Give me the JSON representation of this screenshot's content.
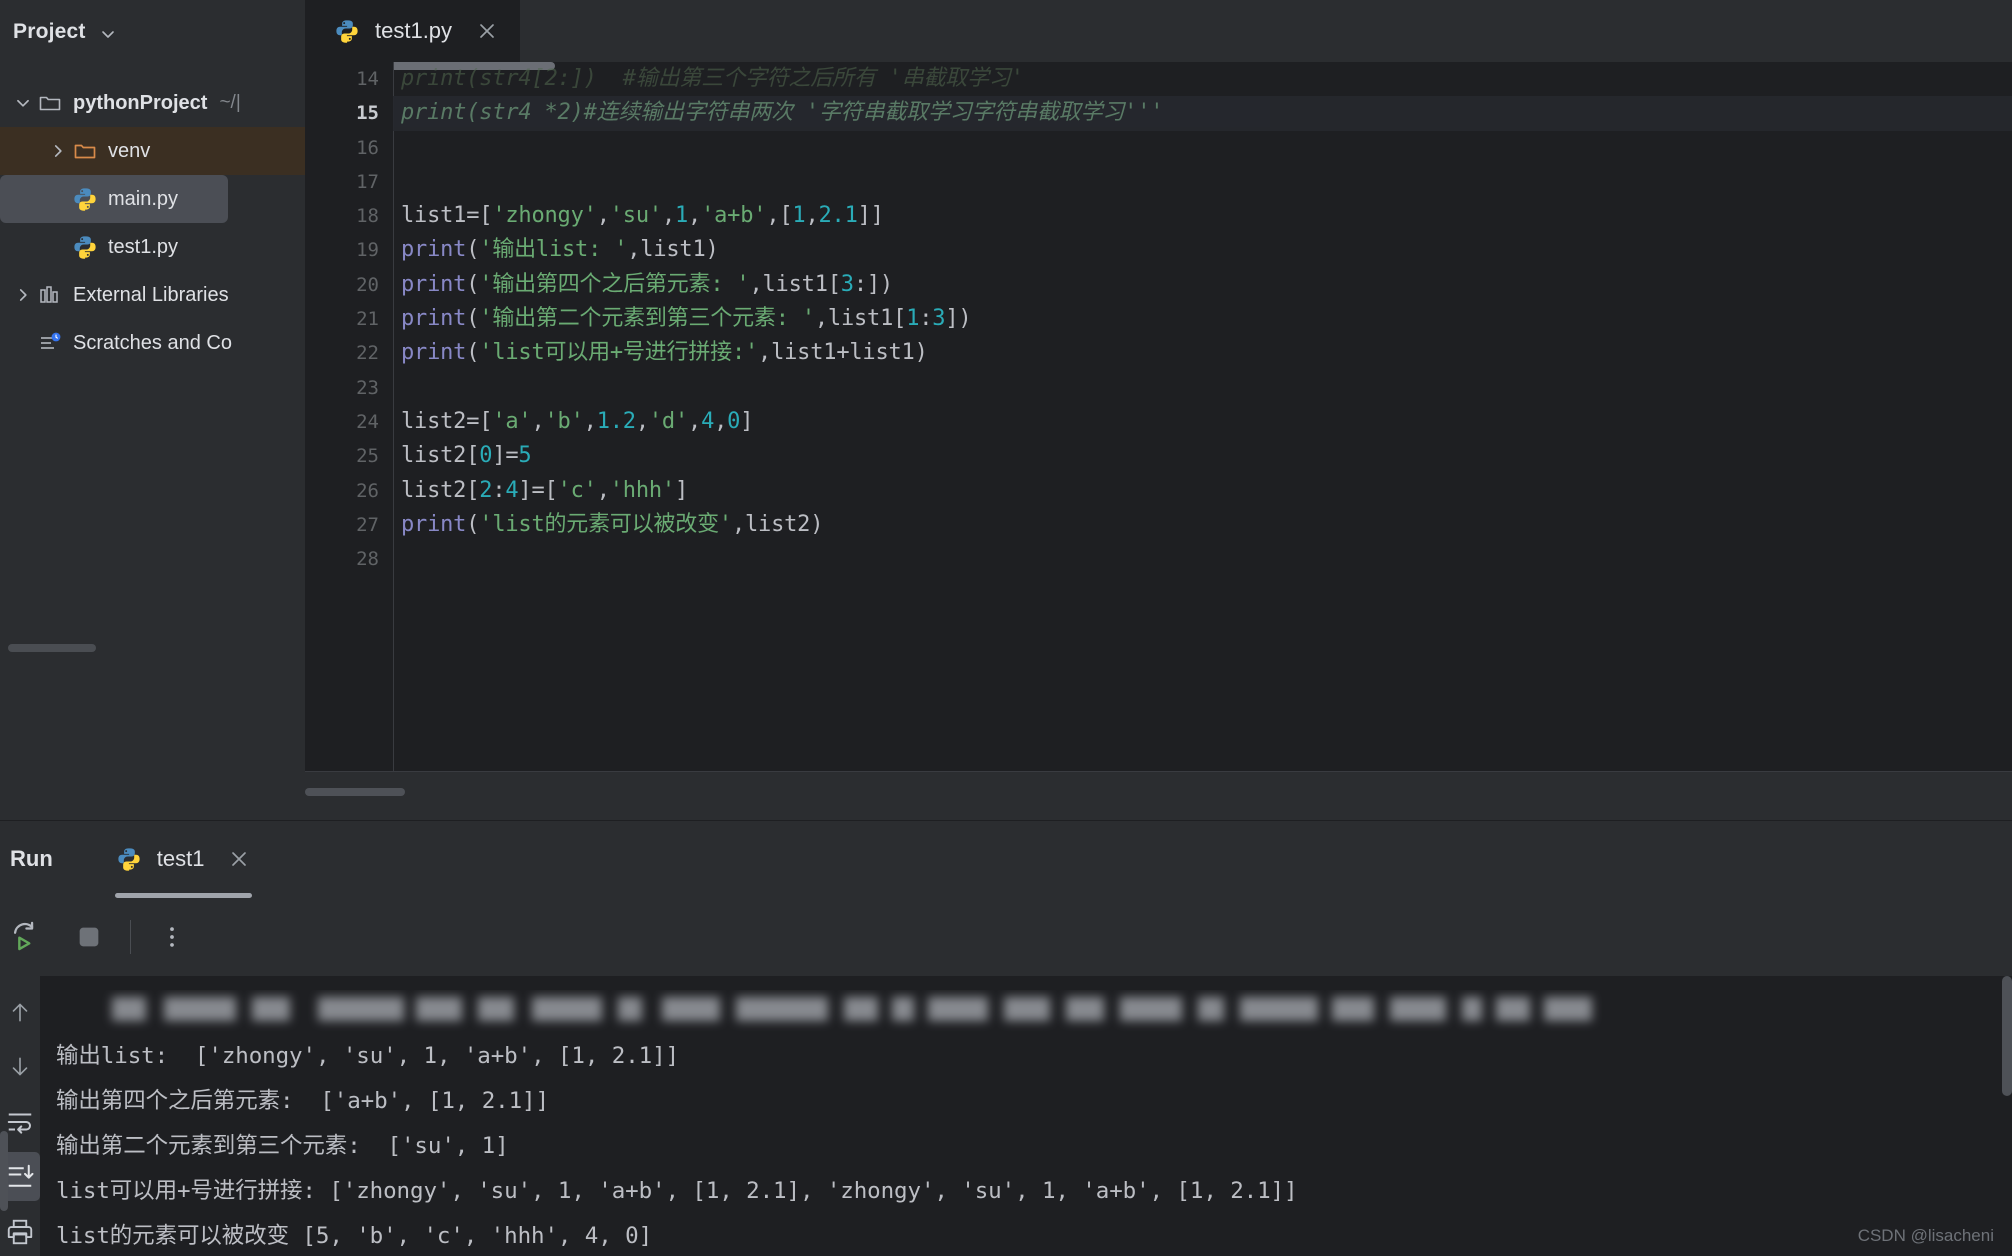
{
  "sidebar": {
    "title": "Project",
    "collapse_icon": "chevron-down-icon",
    "items": [
      {
        "label": "pythonProject",
        "suffix": "~/|",
        "icon": "folder-icon",
        "arrow": "chevron-down-icon",
        "level": 0
      },
      {
        "label": "venv",
        "suffix": "",
        "icon": "folder-orange-icon",
        "arrow": "chevron-right-icon",
        "level": 1
      },
      {
        "label": "main.py",
        "suffix": "",
        "icon": "python-file-icon",
        "arrow": "",
        "level": 1
      },
      {
        "label": "test1.py",
        "suffix": "",
        "icon": "python-file-icon",
        "arrow": "",
        "level": 1
      },
      {
        "label": "External Libraries",
        "suffix": "",
        "icon": "library-icon",
        "arrow": "chevron-right-icon",
        "level": 0
      },
      {
        "label": "Scratches and Co",
        "suffix": "",
        "icon": "scratches-icon",
        "arrow": "",
        "level": 0
      }
    ]
  },
  "editor": {
    "tab": {
      "label": "test1.py",
      "icon": "python-file-icon",
      "close_icon": "close-icon"
    },
    "first_line_number": 14,
    "current_line": 15,
    "lines": [
      {
        "n": 14,
        "text": "print(str4[2:])  #输出第三个字符之后所有 '串截取学习'",
        "style": "faded"
      },
      {
        "n": 15,
        "text": "print(str4 *2)#连续输出字符串两次 '字符串截取学习字符串截取学习'''",
        "style": "dim"
      },
      {
        "n": 16,
        "text": "",
        "style": "plain"
      },
      {
        "n": 17,
        "text": "",
        "style": "plain"
      },
      {
        "n": 18,
        "text": "list1=['zhongy','su',1,'a+b',[1,2.1]]",
        "style": "plain"
      },
      {
        "n": 19,
        "text": "print('输出list: ',list1)",
        "style": "plain"
      },
      {
        "n": 20,
        "text": "print('输出第四个之后第元素: ',list1[3:])",
        "style": "plain"
      },
      {
        "n": 21,
        "text": "print('输出第二个元素到第三个元素: ',list1[1:3])",
        "style": "plain"
      },
      {
        "n": 22,
        "text": "print('list可以用+号进行拼接:',list1+list1)",
        "style": "plain"
      },
      {
        "n": 23,
        "text": "",
        "style": "plain"
      },
      {
        "n": 24,
        "text": "list2=['a','b',1.2,'d',4,0]",
        "style": "plain"
      },
      {
        "n": 25,
        "text": "list2[0]=5",
        "style": "plain"
      },
      {
        "n": 26,
        "text": "list2[2:4]=['c','hhh']",
        "style": "plain"
      },
      {
        "n": 27,
        "text": "print('list的元素可以被改变',list2)",
        "style": "plain"
      },
      {
        "n": 28,
        "text": "",
        "style": "plain"
      }
    ]
  },
  "run_panel": {
    "title": "Run",
    "tab": {
      "label": "test1",
      "icon": "python-file-icon",
      "close_icon": "close-icon"
    },
    "toolbar": [
      {
        "name": "rerun-button",
        "icon": "rerun-icon"
      },
      {
        "name": "stop-button",
        "icon": "stop-icon"
      },
      {
        "name": "more-options-button",
        "icon": "kebab-menu-icon"
      }
    ],
    "console_side_buttons": [
      {
        "name": "scroll-up-button",
        "icon": "arrow-up-icon",
        "active": false
      },
      {
        "name": "scroll-down-button",
        "icon": "arrow-down-icon",
        "active": false
      },
      {
        "name": "soft-wrap-button",
        "icon": "soft-wrap-icon",
        "active": false
      },
      {
        "name": "scroll-to-end-button",
        "icon": "scroll-to-end-icon",
        "active": true
      },
      {
        "name": "print-button",
        "icon": "print-icon",
        "active": false
      }
    ],
    "console_output": [
      "输出list:  ['zhongy', 'su', 1, 'a+b', [1, 2.1]]",
      "输出第四个之后第元素:  ['a+b', [1, 2.1]]",
      "输出第二个元素到第三个元素:  ['su', 1]",
      "list可以用+号进行拼接: ['zhongy', 'su', 1, 'a+b', [1, 2.1], 'zhongy', 'su', 1, 'a+b', [1, 2.1]]",
      "list的元素可以被改变 [5, 'b', 'c', 'hhh', 4, 0]"
    ],
    "redacted_first_line": "（命令行已被模糊处理）"
  },
  "watermark": "CSDN @lisacheni",
  "colors": {
    "background": "#2b2d30",
    "editor_background": "#1e1f22",
    "text": "#dfe1e5",
    "keyword": "#8888c6",
    "string": "#6aab73",
    "number": "#2aacb8",
    "comment": "#7a7e85",
    "selection": "#4b4e55",
    "venv_highlight": "#3b2f22"
  }
}
